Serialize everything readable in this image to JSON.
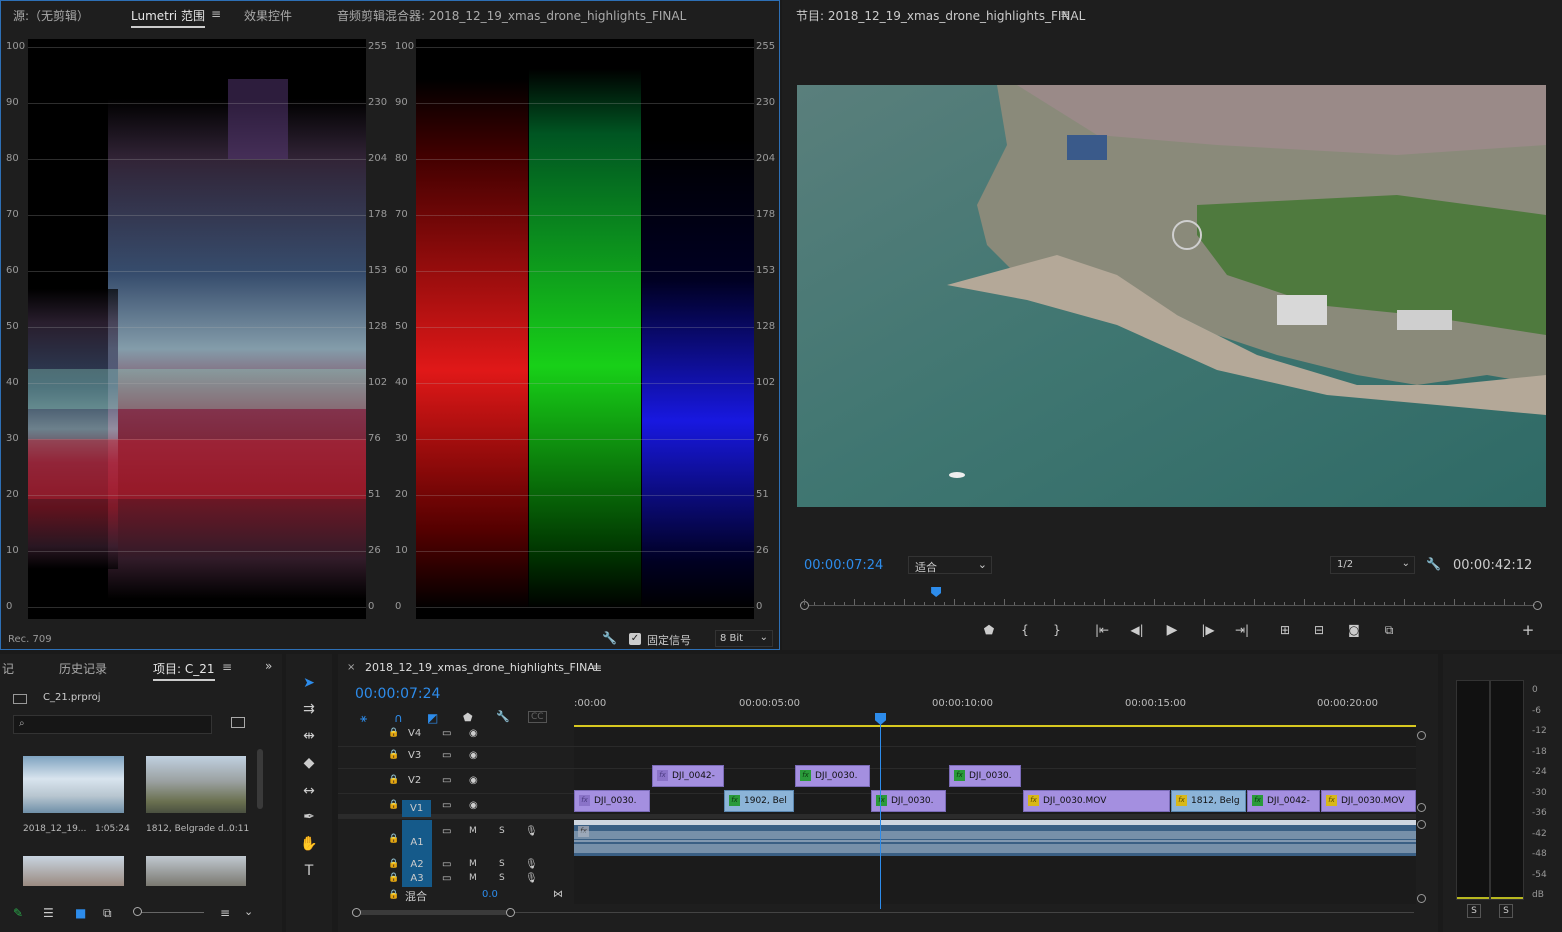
{
  "scopes_panel": {
    "tabs": [
      "源:（无剪辑）",
      "Lumetri 范围",
      "效果控件",
      "音频剪辑混合器: 2018_12_19_xmas_drone_highlights_FINAL"
    ],
    "left_scale": [
      "100",
      "90",
      "80",
      "70",
      "60",
      "50",
      "40",
      "30",
      "20",
      "10",
      "0"
    ],
    "right_scale": [
      "255",
      "230",
      "204",
      "178",
      "153",
      "128",
      "102",
      "76",
      "51",
      "26",
      "0"
    ],
    "colorspace": "Rec. 709",
    "clamp_label": "固定信号",
    "bit_depth": "8 Bit"
  },
  "program_monitor": {
    "title": "节目: 2018_12_19_xmas_drone_highlights_FINAL",
    "timecode": "00:00:07:24",
    "fit": "适合",
    "resolution": "1/2",
    "duration": "00:00:42:12",
    "playhead_fraction": 0.18
  },
  "project_panel": {
    "tabs": [
      "记",
      "历史记录",
      "项目: C_21"
    ],
    "project_file": "C_21.prproj",
    "search_placeholder": "",
    "items": [
      {
        "name": "2018_12_19...",
        "duration": "1:05:24"
      },
      {
        "name": "1812, Belgrade d...",
        "duration": "0:11"
      }
    ]
  },
  "timeline": {
    "title": "2018_12_19_xmas_drone_highlights_FINAL",
    "timecode": "00:00:07:24",
    "ruler": [
      ":00:00",
      "00:00:05:00",
      "00:00:10:00",
      "00:00:15:00",
      "00:00:20:00"
    ],
    "tracks_video": [
      "V4",
      "V3",
      "V2",
      "V1"
    ],
    "tracks_audio": [
      "A1",
      "A2",
      "A3"
    ],
    "mix_label": "混合",
    "mix_value": "0.0",
    "m_label": "M",
    "s_label": "S",
    "clips": {
      "v2": [
        {
          "label": "DJI_0042-",
          "color": "purple",
          "fx": "purple"
        },
        {
          "label": "DJI_0030.",
          "color": "purple",
          "fx": "green"
        },
        {
          "label": "DJI_0030.",
          "color": "purple",
          "fx": "green"
        }
      ],
      "v1": [
        {
          "label": "DJI_0030.",
          "color": "purple",
          "fx": "purple"
        },
        {
          "label": "1902, Bel",
          "color": "blue",
          "fx": "green"
        },
        {
          "label": "DJI_0030.",
          "color": "purple",
          "fx": "green"
        },
        {
          "label": "DJI_0030.MOV",
          "color": "purple",
          "fx": "yellow"
        },
        {
          "label": "1812, Belg",
          "color": "blue",
          "fx": "yellow"
        },
        {
          "label": "DJI_0042-",
          "color": "purple",
          "fx": "green"
        },
        {
          "label": "DJI_0030.MOV",
          "color": "purple",
          "fx": "yellow"
        }
      ]
    }
  },
  "audio_meter": {
    "scale": [
      "0",
      "-6",
      "-12",
      "-18",
      "-24",
      "-30",
      "-36",
      "-42",
      "-48",
      "-54",
      "dB"
    ],
    "solo": [
      "S",
      "S"
    ]
  },
  "colors": {
    "accent": "#2d8ceb",
    "clip_purple": "#a48fe0",
    "clip_blue": "#8cb4d8",
    "fx_green": "#2a9a3a",
    "fx_yellow": "#d8b818"
  }
}
